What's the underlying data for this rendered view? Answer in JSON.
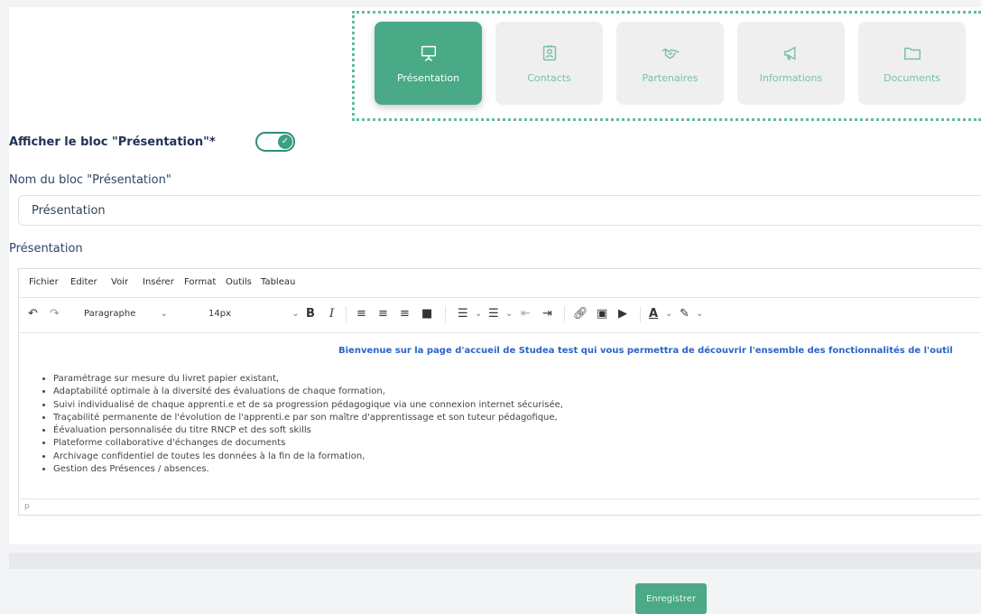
{
  "tabs": [
    {
      "label": "Présentation",
      "icon": "presentation-board-icon",
      "active": true
    },
    {
      "label": "Contacts",
      "icon": "contact-card-icon",
      "active": false
    },
    {
      "label": "Partenaires",
      "icon": "handshake-icon",
      "active": false
    },
    {
      "label": "Informations",
      "icon": "megaphone-icon",
      "active": false
    },
    {
      "label": "Documents",
      "icon": "folder-icon",
      "active": false
    }
  ],
  "settings": {
    "show_block_label": "Afficher le bloc \"Présentation\"*",
    "show_block_enabled": true,
    "block_name_label": "Nom du bloc \"Présentation\"",
    "block_name_value": "Présentation",
    "content_label": "Présentation"
  },
  "editor": {
    "menu": [
      "Fichier",
      "Editer",
      "Voir",
      "Insérer",
      "Format",
      "Outils",
      "Tableau"
    ],
    "format_select": "Paragraphe",
    "size_select": "14px",
    "intro": "Bienvenue sur la page d'accueil de Studea test qui vous permettra de découvrir l'ensemble des fonctionnalités de l'outil",
    "bullets": [
      "Paramétrage sur mesure du livret papier existant,",
      "Adaptabilité optimale à la diversité des évaluations de chaque formation,",
      "Suivi individualisé de chaque apprenti.e et de sa progression pédagogique via une connexion internet sécurisée,",
      "Traçabilité permanente de l'évolution de l'apprenti.e par son maître d'apprentissage et son tuteur pédagofique,",
      "Éévaluation personnalisée du titre RNCP et des soft skills",
      "Plateforme collaborative d'échanges de documents",
      "Archivage confidentiel de toutes les données à la fin de la formation,",
      "Gestion des Présences / absences."
    ],
    "status_path": "p"
  },
  "save_label": "Enregistrer",
  "colors": {
    "accent": "#4aa986",
    "title": "#1f3154",
    "link_blue": "#2a64c9"
  }
}
